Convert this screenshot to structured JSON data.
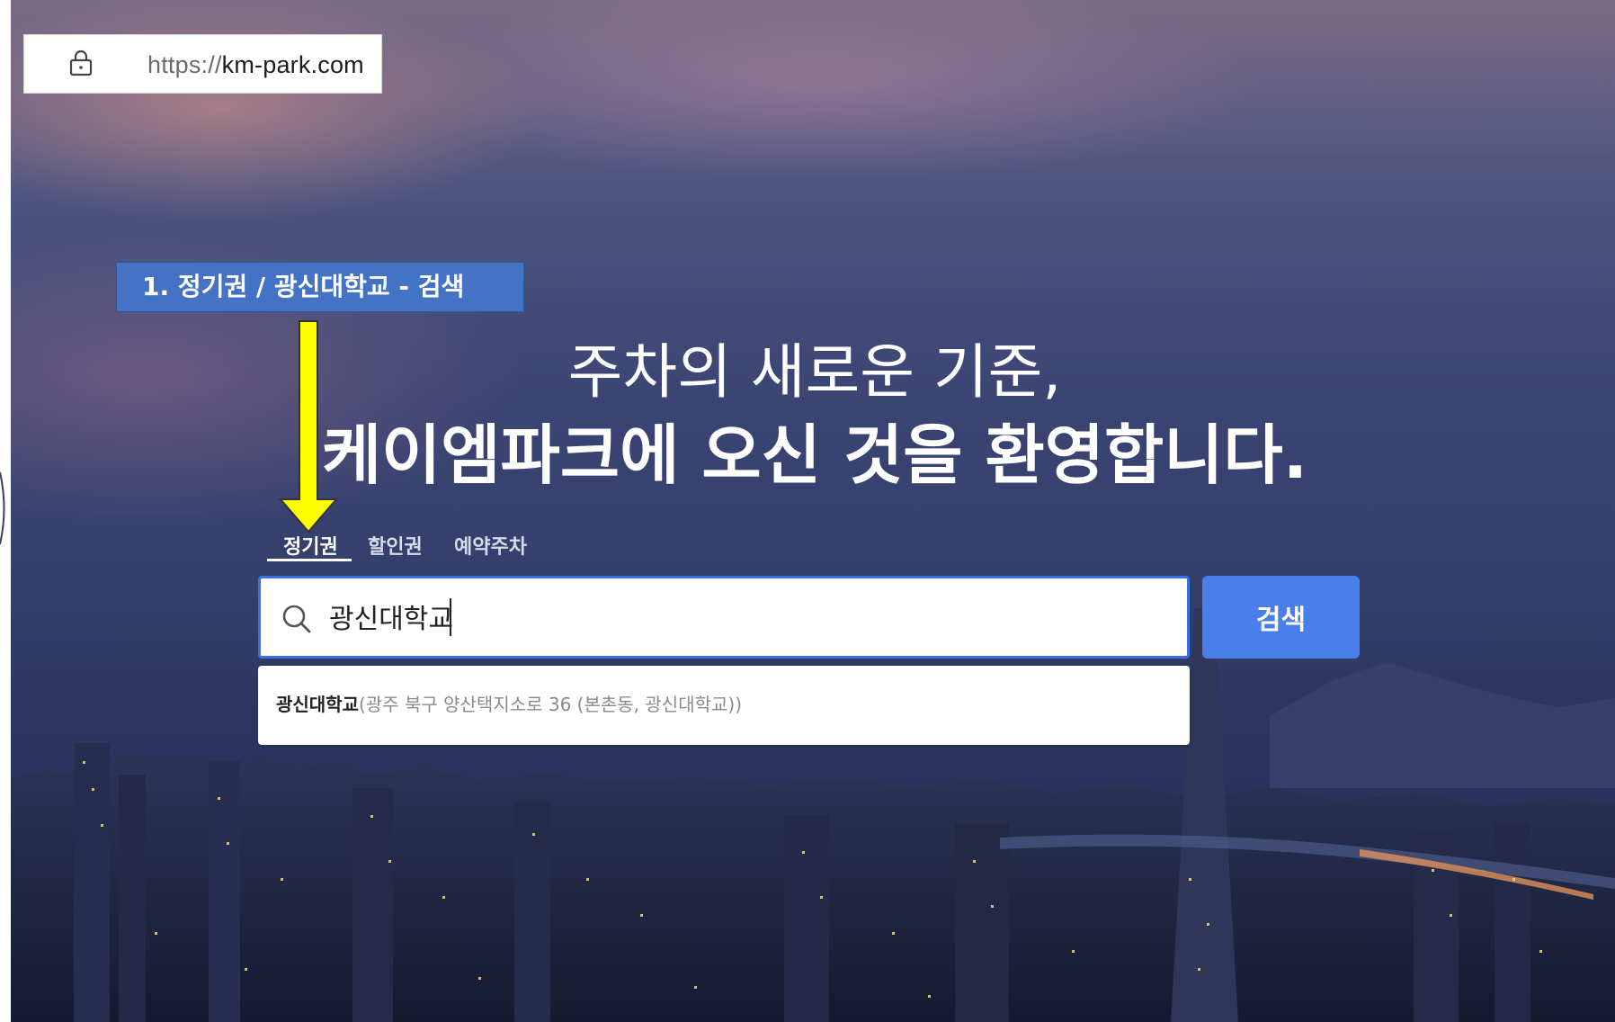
{
  "browser": {
    "url_scheme": "https://",
    "url_host": "km-park.com"
  },
  "annotation": {
    "text": "1. 정기권 / 광신대학교 - 검색",
    "box_color": "#4472c4",
    "arrow_color": "#ffff00"
  },
  "hero": {
    "headline_line1": "주차의 새로운 기준,",
    "headline_line2": "케이엠파크에 오신 것을 환영합니다."
  },
  "tabs": [
    {
      "label": "정기권",
      "active": true
    },
    {
      "label": "할인권",
      "active": false
    },
    {
      "label": "예약주차",
      "active": false
    }
  ],
  "search": {
    "value": "광신대학교",
    "button_label": "검색",
    "button_color": "#4a7ee8",
    "border_color": "#3e6fe0"
  },
  "suggestions": [
    {
      "name": "광신대학교",
      "address": "(광주 북구 양산택지소로 36 (본촌동, 광신대학교))"
    }
  ],
  "icons": {
    "lock": "lock-icon",
    "search": "search-icon",
    "arrow": "arrow-down-icon"
  }
}
